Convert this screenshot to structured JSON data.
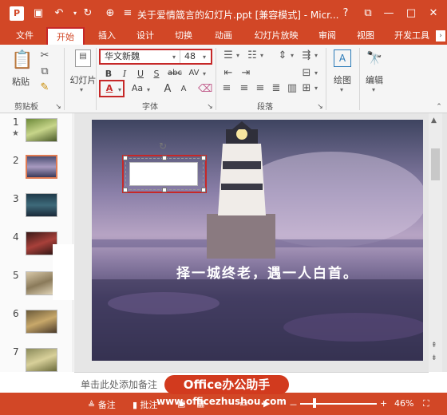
{
  "window": {
    "title": "关于爱情箴言的幻灯片.ppt [兼容模式] - Micr...",
    "help": "?",
    "controls": {
      "restore": "⧉",
      "minimize": "—",
      "maximize": "□",
      "close": "✕"
    }
  },
  "quick_access": {
    "logo": "P",
    "save_icon": "💾",
    "undo_icon": "↶",
    "redo_icon": "↻",
    "touch_icon": "⌖",
    "more": "="
  },
  "tabs": [
    {
      "label": "文件"
    },
    {
      "label": "开始"
    },
    {
      "label": "插入"
    },
    {
      "label": "设计"
    },
    {
      "label": "切换"
    },
    {
      "label": "动画"
    },
    {
      "label": "幻灯片放映"
    },
    {
      "label": "审阅"
    },
    {
      "label": "视图"
    },
    {
      "label": "开发工具"
    }
  ],
  "ribbon": {
    "clipboard": {
      "paste": "粘贴",
      "group": "剪贴板"
    },
    "slides": {
      "label": "幻灯片"
    },
    "font": {
      "name": "华文新魏",
      "size": "48",
      "group": "字体",
      "bold": "B",
      "italic": "I",
      "underline": "U",
      "strike": "S",
      "abc": "abc",
      "av": "AV",
      "color": "A",
      "aa": "Aa",
      "grow": "A",
      "shrink": "A"
    },
    "paragraph": {
      "group": "段落"
    },
    "drawing": {
      "label": "绘图"
    },
    "editing": {
      "label": "编辑"
    }
  },
  "slides_pane": {
    "items": [
      {
        "num": "1"
      },
      {
        "num": "2"
      },
      {
        "num": "3"
      },
      {
        "num": "4"
      },
      {
        "num": "5"
      },
      {
        "num": "6"
      },
      {
        "num": "7"
      }
    ],
    "star": "★"
  },
  "slide": {
    "caption": "择一城终老，遇一人白首。"
  },
  "notes": {
    "placeholder": "单击此处添加备注"
  },
  "statusbar": {
    "notes": "≜ 备注",
    "comments": "▮ 批注",
    "zoom_minus": "－",
    "zoom_plus": "+",
    "zoom": "46%"
  },
  "watermark": {
    "badge": "Office办公助手",
    "url": "www.officezhushou.com"
  }
}
